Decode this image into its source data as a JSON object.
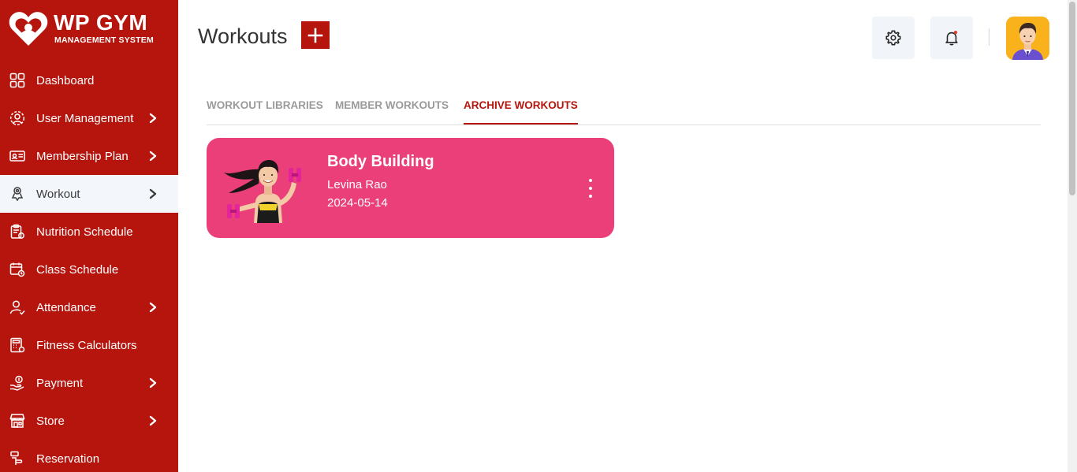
{
  "brand": {
    "title": "WP GYM",
    "subtitle": "MANAGEMENT SYSTEM"
  },
  "sidebar": {
    "items": [
      {
        "label": "Dashboard",
        "icon": "dashboard-grid-icon",
        "has_submenu": false
      },
      {
        "label": "User Management",
        "icon": "user-management-icon",
        "has_submenu": true
      },
      {
        "label": "Membership Plan",
        "icon": "membership-card-icon",
        "has_submenu": true
      },
      {
        "label": "Workout",
        "icon": "workout-icon",
        "has_submenu": true,
        "active": true
      },
      {
        "label": "Nutrition Schedule",
        "icon": "nutrition-clipboard-icon",
        "has_submenu": false
      },
      {
        "label": "Class Schedule",
        "icon": "calendar-clock-icon",
        "has_submenu": false
      },
      {
        "label": "Attendance",
        "icon": "attendance-user-check-icon",
        "has_submenu": true
      },
      {
        "label": "Fitness Calculators",
        "icon": "calculator-icon",
        "has_submenu": false
      },
      {
        "label": "Payment",
        "icon": "payment-hand-icon",
        "has_submenu": true
      },
      {
        "label": "Store",
        "icon": "store-icon",
        "has_submenu": true
      },
      {
        "label": "Reservation",
        "icon": "reservation-icon",
        "has_submenu": false
      }
    ]
  },
  "header": {
    "title": "Workouts",
    "add_icon": "plus-icon"
  },
  "tabs": [
    {
      "label": "WORKOUT LIBRARIES",
      "active": false
    },
    {
      "label": "MEMBER WORKOUTS",
      "active": false
    },
    {
      "label": "ARCHIVE WORKOUTS",
      "active": true
    }
  ],
  "workout_card": {
    "title": "Body Building",
    "member": "Levina Rao",
    "date": "2024-05-14"
  },
  "colors": {
    "brand_red": "#b6150e",
    "card_pink": "#ea3f78",
    "header_button_bg": "#f1f4f8",
    "avatar_bg": "#f9b21c",
    "notification_dot": "#e53935"
  }
}
